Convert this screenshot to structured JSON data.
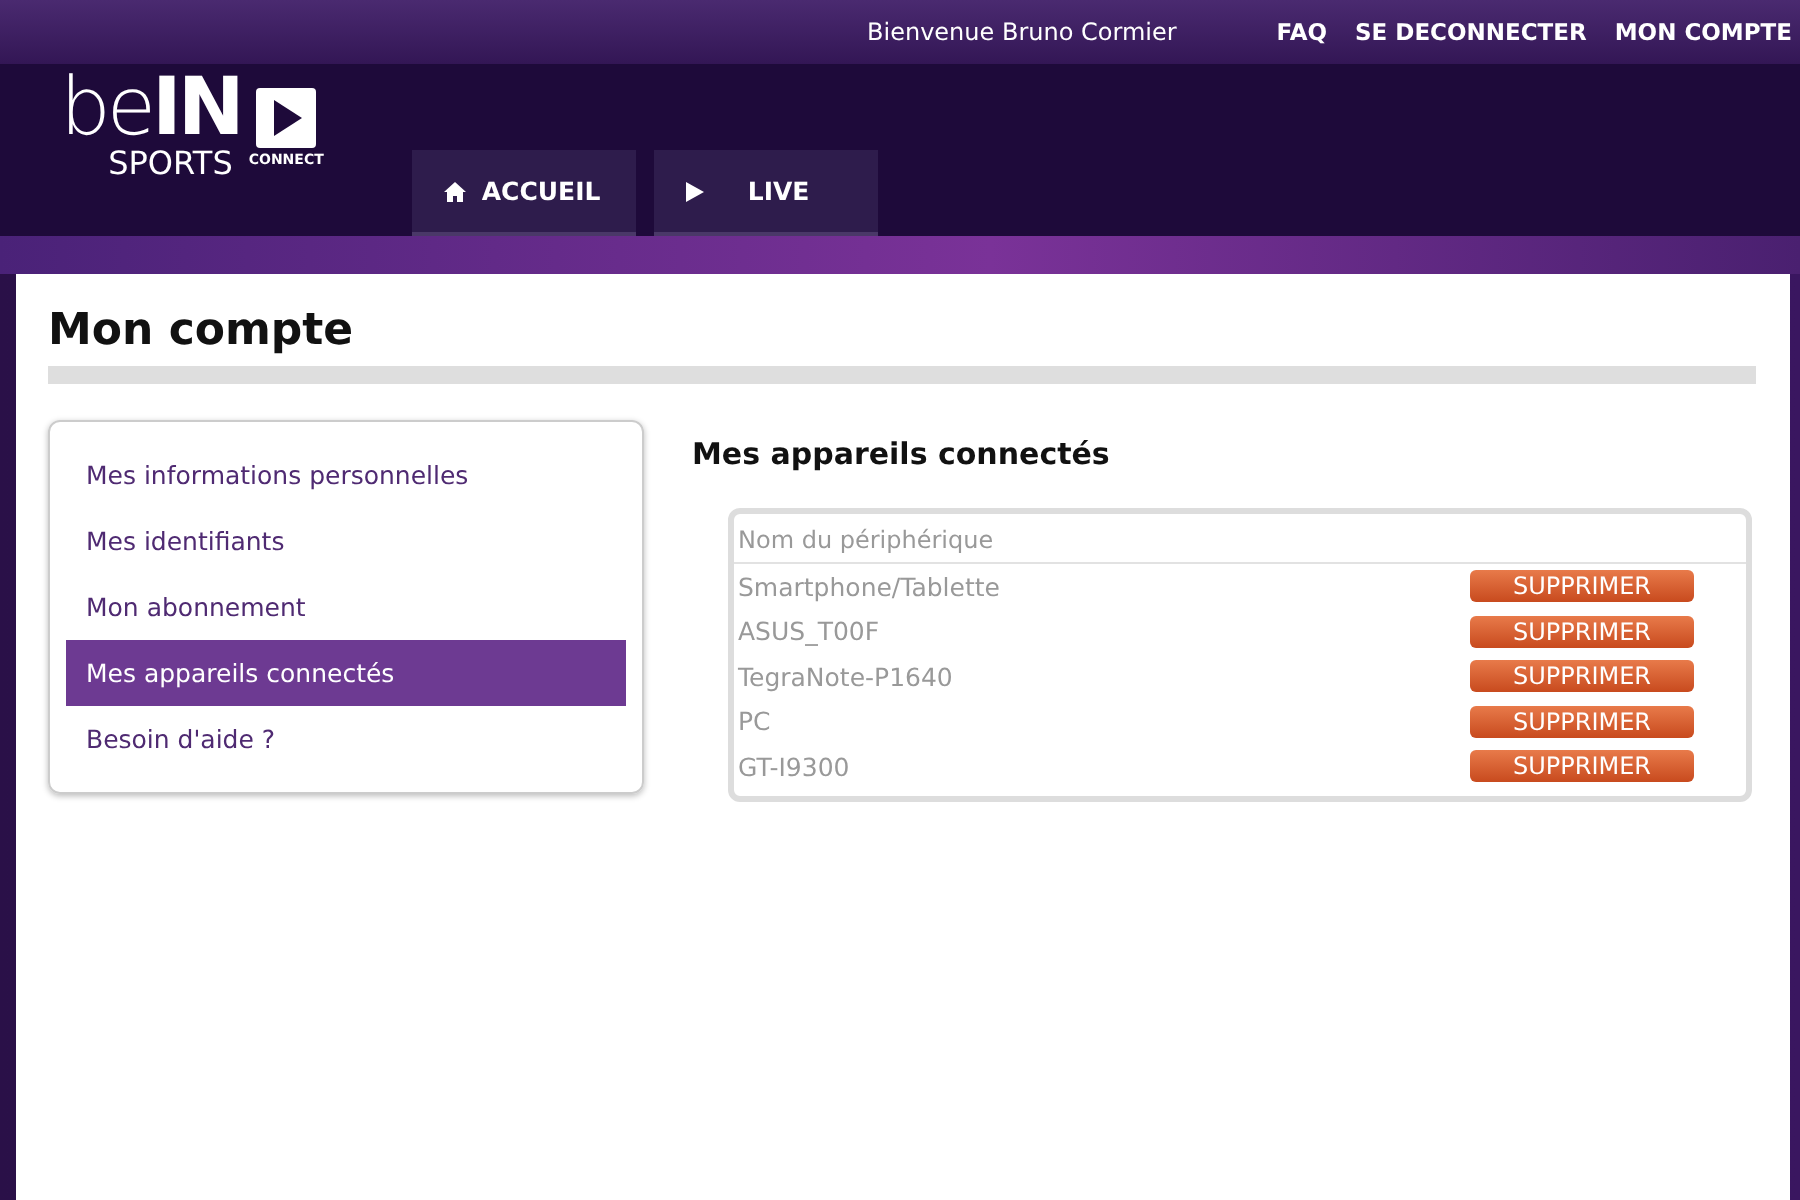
{
  "top_bar": {
    "welcome": "Bienvenue Bruno Cormier",
    "links": [
      "FAQ",
      "SE DECONNECTER",
      "MON COMPTE"
    ]
  },
  "logo": {
    "be": "be",
    "in": "IN",
    "sports": "SPORTS",
    "connect": "CONNECT"
  },
  "nav_tabs": [
    {
      "label": "ACCUEIL",
      "kind": "home",
      "selected": false
    },
    {
      "label": "LIVE",
      "kind": "live",
      "selected": false
    }
  ],
  "page_title": "Mon compte",
  "sidebar": {
    "items": [
      {
        "label": "Mes informations personnelles",
        "selected": false
      },
      {
        "label": "Mes identifiants",
        "selected": false
      },
      {
        "label": "Mon abonnement",
        "selected": false
      },
      {
        "label": "Mes appareils connectés",
        "selected": true
      },
      {
        "label": "Besoin d'aide ?",
        "selected": false
      }
    ]
  },
  "section_title": "Mes appareils connectés",
  "devices_table": {
    "column": "Nom du périphérique",
    "rows": [
      {
        "name": "Smartphone/Tablette",
        "action": "SUPPRIMER"
      },
      {
        "name": "ASUS_T00F",
        "action": "SUPPRIMER"
      },
      {
        "name": "TegraNote-P1640",
        "action": "SUPPRIMER"
      },
      {
        "name": "PC",
        "action": "SUPPRIMER"
      },
      {
        "name": "GT-I9300",
        "action": "SUPPRIMER"
      }
    ]
  }
}
